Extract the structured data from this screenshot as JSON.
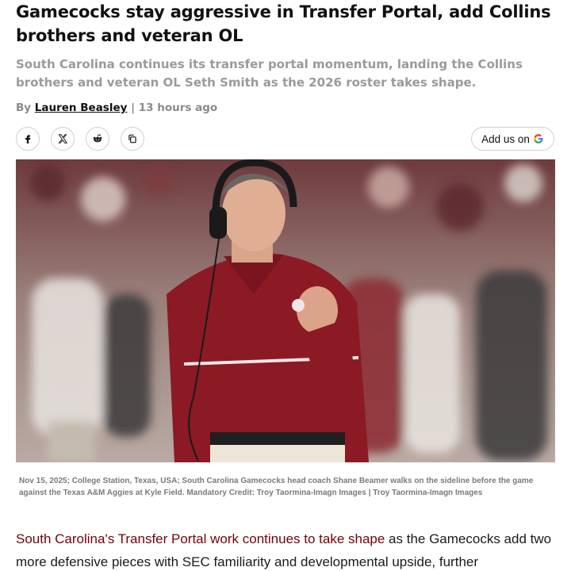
{
  "article": {
    "headline": "Gamecocks stay aggressive in Transfer Portal, add Collins brothers and veteran OL",
    "dek": "South Carolina continues its transfer portal momentum, landing the Collins brothers and veteran OL Seth Smith as the 2026 roster takes shape.",
    "byline_prefix": "By",
    "author": "Lauren Beasley",
    "separator": "|",
    "timestamp": "13 hours ago"
  },
  "share": {
    "buttons": [
      {
        "name": "facebook-share-button",
        "icon": "facebook-icon"
      },
      {
        "name": "x-share-button",
        "icon": "x-icon"
      },
      {
        "name": "reddit-share-button",
        "icon": "reddit-icon"
      },
      {
        "name": "copy-link-button",
        "icon": "copy-icon"
      }
    ],
    "google_label": "Add us on",
    "google_icon": "google-g-icon"
  },
  "photo": {
    "caption": "Nov 15, 2025; College Station, Texas, USA; South Carolina Gamecocks head coach Shane Beamer walks on the sideline before the game against the Texas A&M Aggies at Kyle Field. Mandatory Credit: Troy Taormina-Imagn Images | Troy Taormina-Imagn Images"
  },
  "body": {
    "link_text": "South Carolina's Transfer Portal work continues to take shape",
    "text": " as the Gamecocks add two more defensive pieces with SEC familiarity and developmental upside, further"
  },
  "colors": {
    "link": "#73000a",
    "garnet": "#8b1a25",
    "headline": "#111111",
    "dek": "#9a9a9a"
  }
}
